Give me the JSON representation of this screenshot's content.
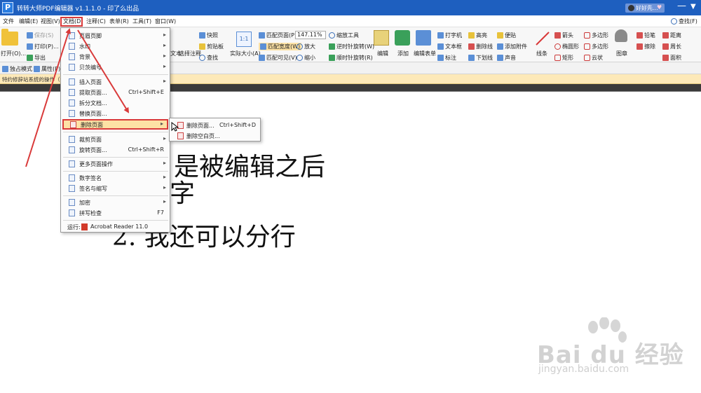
{
  "window": {
    "title": "转转大师PDF编辑器 v1.1.1.0 - 印了么出品",
    "app_icon": "P",
    "user_name": "好好先...",
    "minimize": "—",
    "menu_triangle": "▼"
  },
  "menubar": {
    "items": [
      "文件",
      "编辑(E)",
      "视图(V)",
      "文档(D)",
      "注释(C)",
      "表单(R)",
      "工具(T)",
      "窗口(W)"
    ],
    "search": "查找(F)"
  },
  "ribbon": {
    "open": "打开(O)...",
    "save": "保存(S)",
    "print": "打印(P)...",
    "export": "导出",
    "single_page_mode": "独占模式",
    "properties": "属性(P)...",
    "text": "文本",
    "select_annotation": "选择注释",
    "snapshot": "快照",
    "clipboard": "剪贴板",
    "find": "查找",
    "actual_size": "实际大小(A)",
    "fit_page": "匹配页面(P)",
    "fit_width": "匹配宽度(W)",
    "fit_visible": "匹配可见(V)",
    "zoom_value": "147.11%",
    "zoom_tool": "缩放工具",
    "zoom_in": "放大",
    "zoom_out": "缩小",
    "rotate_ccw": "逆时针旋转(W)",
    "rotate_cw": "顺时针旋转(R)",
    "edit": "编辑",
    "add": "添加",
    "edit_form": "编辑表单",
    "typewriter": "打字机",
    "textbox": "文本框",
    "callout": "标注",
    "highlight": "高亮",
    "strikeout": "删除线",
    "underline": "下划线",
    "note": "便贴",
    "attach_file": "添加附件",
    "sound": "声音",
    "line": "线条",
    "arrow": "箭头",
    "ellipse": "椭圆形",
    "rectangle": "矩形",
    "polygon": "多边形",
    "polyline": "多边形",
    "cloud": "云状",
    "stamp": "图章",
    "pencil": "铅笔",
    "eraser": "擦除",
    "distance": "距离",
    "perimeter": "周长",
    "area": "面积"
  },
  "notice": "特约修辞站系统的操作（保存",
  "doc_menu": {
    "items": [
      {
        "label": "页眉页脚",
        "arrow": "▸"
      },
      {
        "label": "水印",
        "arrow": "▸"
      },
      {
        "label": "背景",
        "arrow": "▸"
      },
      {
        "label": "贝茨编号",
        "arrow": "▸"
      },
      {
        "label": "插入页面",
        "arrow": "▸"
      },
      {
        "label": "提取页面...",
        "shortcut": "Ctrl+Shift+E"
      },
      {
        "label": "拆分文档..."
      },
      {
        "label": "替换页面..."
      },
      {
        "label": "删除页面",
        "arrow": "▸"
      },
      {
        "label": "裁剪页面",
        "arrow": "▸"
      },
      {
        "label": "旋转页面...",
        "shortcut": "Ctrl+Shift+R"
      },
      {
        "label": "更多页面操作",
        "arrow": "▸"
      },
      {
        "label": "数字签名",
        "arrow": "▸"
      },
      {
        "label": "签名与缩写",
        "arrow": "▸"
      },
      {
        "label": "加密",
        "arrow": "▸"
      },
      {
        "label": "拼写检查",
        "shortcut": "F7"
      }
    ],
    "run_label": "运行:",
    "run_app": "Acrobat Reader 11.0"
  },
  "sub_menu": {
    "items": [
      {
        "label": "删除页面...",
        "shortcut": "Ctrl+Shift+D"
      },
      {
        "label": "删除空白页..."
      }
    ]
  },
  "document": {
    "line1": "是被编辑之后",
    "line2": "字",
    "line3": "2. 我还可以分行"
  },
  "watermark": {
    "brand": "Bai du 经验",
    "url": "jingyan.baidu.com"
  },
  "colors": {
    "titlebar": "#1e5fbf",
    "annotation_red": "#d93a3a",
    "menu_highlight": "#fde2a5",
    "notice_bg": "#fde9b8"
  }
}
